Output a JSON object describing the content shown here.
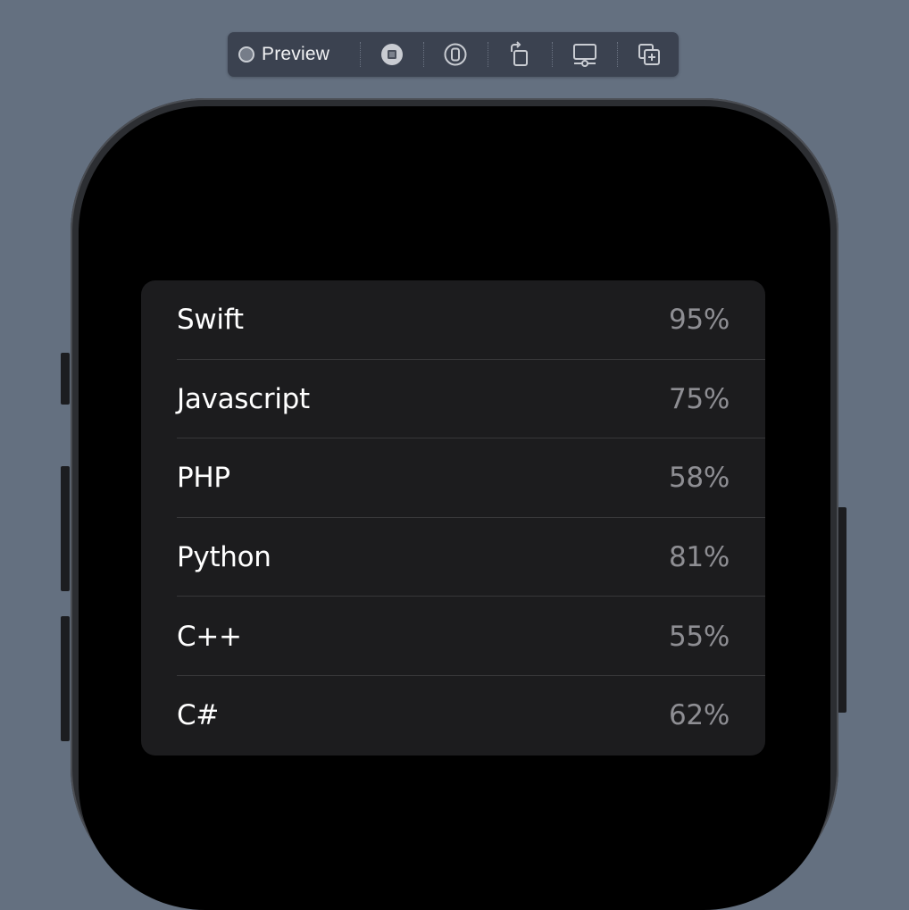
{
  "toolbar": {
    "preview_label": "Preview",
    "icons": [
      "live-preview-dot-icon",
      "stop-icon",
      "device-pin-icon",
      "rotate-device-icon",
      "device-settings-icon",
      "duplicate-preview-icon"
    ]
  },
  "colors": {
    "backdrop": "#647080",
    "toolbar": "#3b4250",
    "screen": "#000000",
    "card": "#1c1c1e",
    "label": "#ffffff",
    "value": "#8e8e93",
    "divider": "#38383a"
  },
  "list": {
    "items": [
      {
        "label": "Swift",
        "value": "95%"
      },
      {
        "label": "Javascript",
        "value": "75%"
      },
      {
        "label": "PHP",
        "value": "58%"
      },
      {
        "label": "Python",
        "value": "81%"
      },
      {
        "label": "C++",
        "value": "55%"
      },
      {
        "label": "C#",
        "value": "62%"
      }
    ]
  }
}
